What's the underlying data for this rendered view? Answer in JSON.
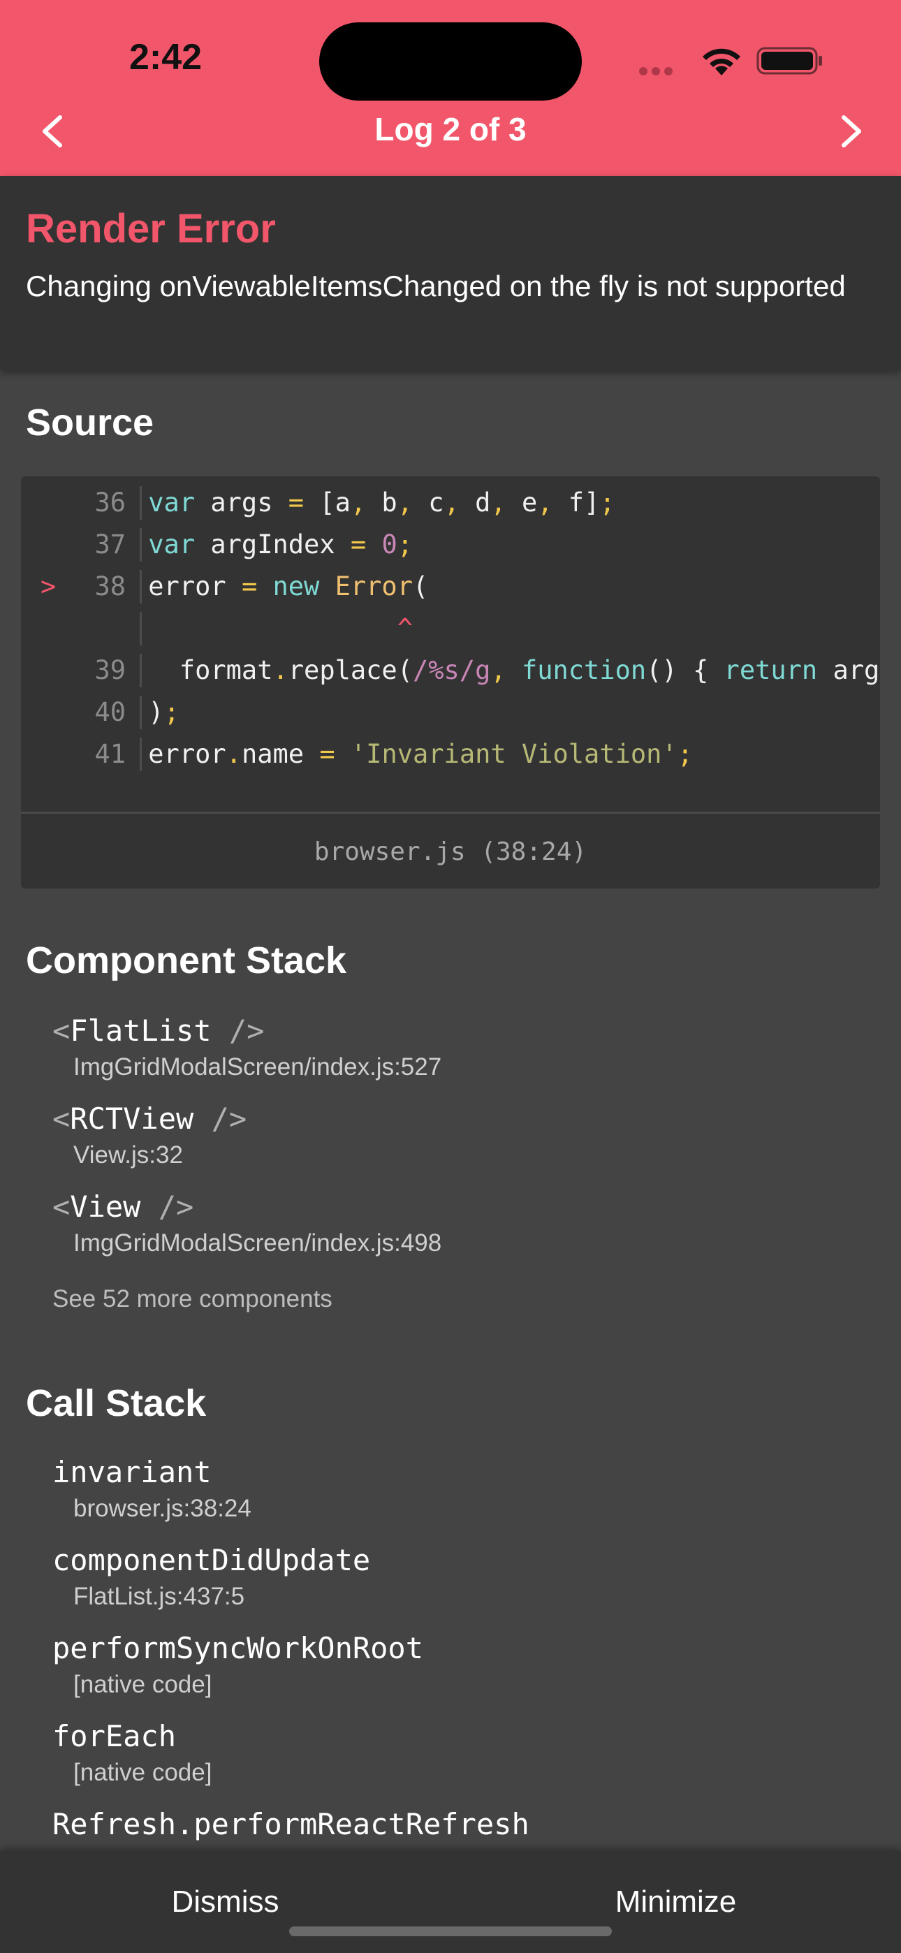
{
  "status_bar": {
    "time": "2:42"
  },
  "header": {
    "title": "Log 2 of 3"
  },
  "error": {
    "title": "Render Error",
    "message": "Changing onViewableItemsChanged on the fly is not supported"
  },
  "source": {
    "title": "Source",
    "lines": [
      {
        "num": "36",
        "marker": "",
        "text": "var args = [a, b, c, d, e, f];"
      },
      {
        "num": "37",
        "marker": "",
        "text": "var argIndex = 0;"
      },
      {
        "num": "38",
        "marker": ">",
        "text": "error = new Error("
      },
      {
        "num": "",
        "marker": "",
        "text": "^"
      },
      {
        "num": "39",
        "marker": "",
        "text": "  format.replace(/%s/g, function() { return args"
      },
      {
        "num": "40",
        "marker": "",
        "text": ");"
      },
      {
        "num": "41",
        "marker": "",
        "text": "error.name = 'Invariant Violation';"
      }
    ],
    "file_location": "browser.js (38:24)"
  },
  "component_stack": {
    "title": "Component Stack",
    "frames": [
      {
        "name": "FlatList",
        "location": "ImgGridModalScreen/index.js:527"
      },
      {
        "name": "RCTView",
        "location": "View.js:32"
      },
      {
        "name": "View",
        "location": "ImgGridModalScreen/index.js:498"
      }
    ],
    "see_more": "See 52 more components"
  },
  "call_stack": {
    "title": "Call Stack",
    "frames": [
      {
        "name": "invariant",
        "location": "browser.js:38:24"
      },
      {
        "name": "componentDidUpdate",
        "location": "FlatList.js:437:5"
      },
      {
        "name": "performSyncWorkOnRoot",
        "location": "[native code]"
      },
      {
        "name": "forEach",
        "location": "[native code]"
      },
      {
        "name": "Refresh.performReactRefresh",
        "location": ""
      }
    ]
  },
  "footer": {
    "dismiss_label": "Dismiss",
    "minimize_label": "Minimize"
  },
  "colors": {
    "header_bg": "#f2566a",
    "error_title": "#f2566a",
    "panel_bg": "#333333",
    "page_bg": "#444444"
  }
}
